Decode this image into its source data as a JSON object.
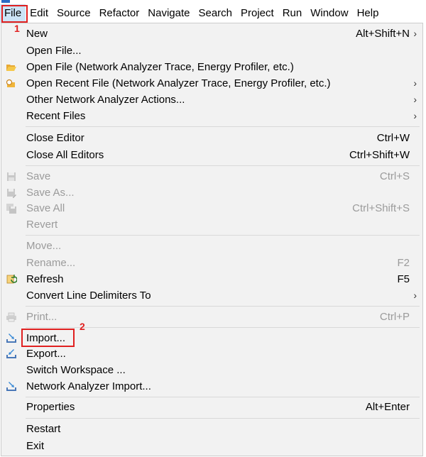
{
  "menubar": {
    "items": [
      "File",
      "Edit",
      "Source",
      "Refactor",
      "Navigate",
      "Search",
      "Project",
      "Run",
      "Window",
      "Help"
    ]
  },
  "file_menu": {
    "items": [
      {
        "label": "New",
        "accel": "Alt+Shift+N",
        "submenu": true
      },
      {
        "label": "Open File..."
      },
      {
        "label": "Open File (Network Analyzer Trace, Energy Profiler, etc.)",
        "icon": "folder-open-icon"
      },
      {
        "label": "Open Recent File (Network Analyzer Trace, Energy Profiler, etc.)",
        "icon": "recent-file-icon",
        "submenu": true
      },
      {
        "label": "Other Network Analyzer Actions...",
        "submenu": true
      },
      {
        "label": "Recent Files",
        "submenu": true
      },
      {
        "label": "Close Editor",
        "accel": "Ctrl+W"
      },
      {
        "label": "Close All Editors",
        "accel": "Ctrl+Shift+W"
      },
      {
        "label": "Save",
        "accel": "Ctrl+S",
        "disabled": true,
        "icon": "save-icon"
      },
      {
        "label": "Save As...",
        "disabled": true,
        "icon": "save-as-icon"
      },
      {
        "label": "Save All",
        "accel": "Ctrl+Shift+S",
        "disabled": true,
        "icon": "save-all-icon"
      },
      {
        "label": "Revert",
        "disabled": true
      },
      {
        "label": "Move...",
        "disabled": true
      },
      {
        "label": "Rename...",
        "accel": "F2",
        "disabled": true
      },
      {
        "label": "Refresh",
        "accel": "F5",
        "icon": "refresh-icon"
      },
      {
        "label": "Convert Line Delimiters To",
        "submenu": true
      },
      {
        "label": "Print...",
        "accel": "Ctrl+P",
        "disabled": true,
        "icon": "print-icon"
      },
      {
        "label": "Import...",
        "icon": "import-icon"
      },
      {
        "label": "Export...",
        "icon": "export-icon"
      },
      {
        "label": "Switch Workspace ..."
      },
      {
        "label": "Network Analyzer Import...",
        "icon": "network-import-icon"
      },
      {
        "label": "Properties",
        "accel": "Alt+Enter"
      },
      {
        "label": "Restart"
      },
      {
        "label": "Exit"
      }
    ]
  },
  "annotations": {
    "step1": "1",
    "step2": "2",
    "color": "#e02020"
  }
}
